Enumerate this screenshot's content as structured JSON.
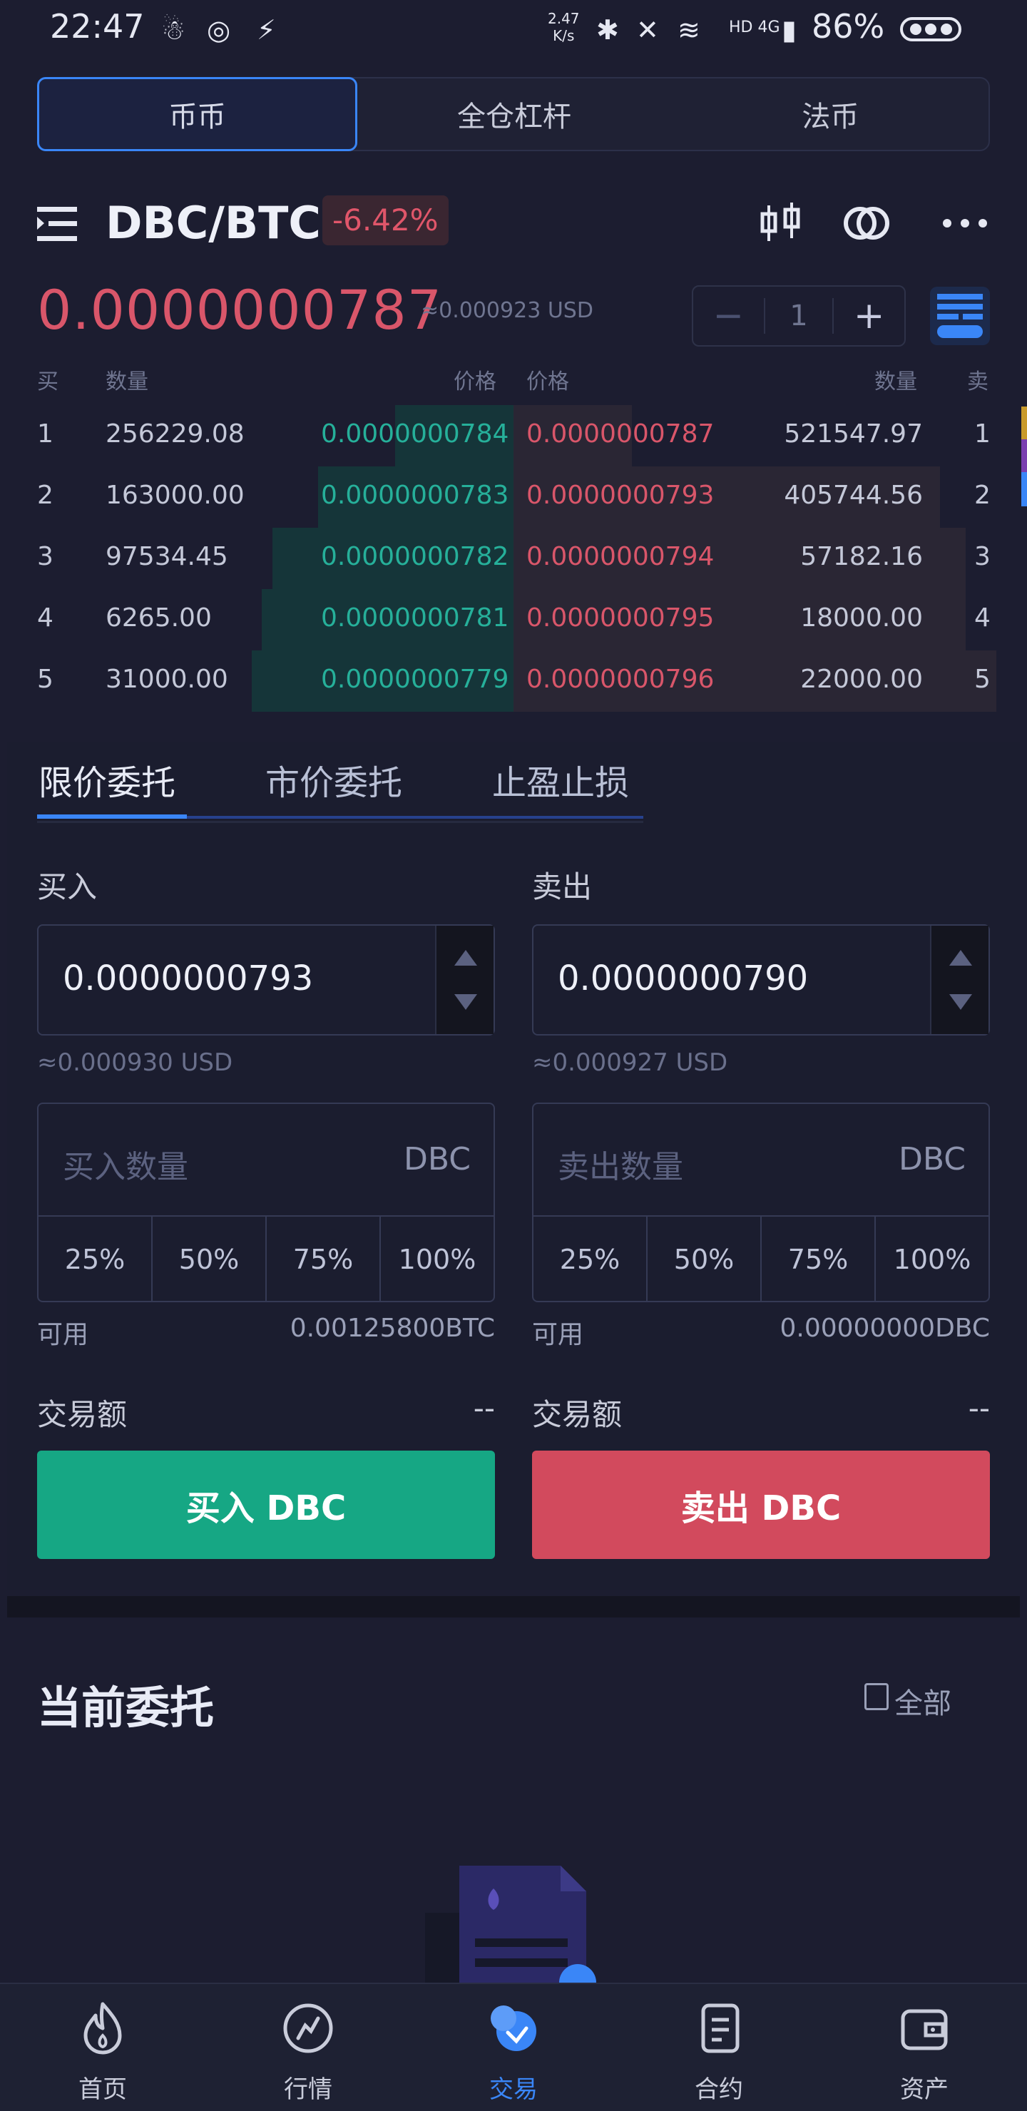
{
  "status_bar": {
    "time": "22:47",
    "net_speed_value": "2.47",
    "net_speed_unit": "K/s",
    "network": "HD 4G",
    "battery": "86%"
  },
  "top_tabs": [
    {
      "label": "币币",
      "active": true
    },
    {
      "label": "全仓杠杆",
      "active": false
    },
    {
      "label": "法币",
      "active": false
    }
  ],
  "pair": {
    "name": "DBC/BTC",
    "change": "-6.42%"
  },
  "price": {
    "last": "0.0000000787",
    "usd": "≈0.000923 USD"
  },
  "depth_stepper": {
    "minus": "−",
    "value": "1",
    "plus": "+"
  },
  "orderbook": {
    "headers": {
      "buy": "买",
      "bid_qty": "数量",
      "bid_price": "价格",
      "ask_price": "价格",
      "ask_qty": "数量",
      "sell": "卖"
    },
    "rows": [
      {
        "idx": "1",
        "bid_qty": "256229.08",
        "bid_price": "0.0000000784",
        "ask_price": "0.0000000787",
        "ask_qty": "521547.97",
        "ask_idx": "1",
        "bid_depth": 0.23,
        "ask_depth": 0.23
      },
      {
        "idx": "2",
        "bid_qty": "163000.00",
        "bid_price": "0.0000000783",
        "ask_price": "0.0000000793",
        "ask_qty": "405744.56",
        "ask_idx": "2",
        "bid_depth": 0.38,
        "ask_depth": 0.83
      },
      {
        "idx": "3",
        "bid_qty": "97534.45",
        "bid_price": "0.0000000782",
        "ask_price": "0.0000000794",
        "ask_qty": "57182.16",
        "ask_idx": "3",
        "bid_depth": 0.47,
        "ask_depth": 0.88
      },
      {
        "idx": "4",
        "bid_qty": "6265.00",
        "bid_price": "0.0000000781",
        "ask_price": "0.0000000795",
        "ask_qty": "18000.00",
        "ask_idx": "4",
        "bid_depth": 0.49,
        "ask_depth": 0.88
      },
      {
        "idx": "5",
        "bid_qty": "31000.00",
        "bid_price": "0.0000000779",
        "ask_price": "0.0000000796",
        "ask_qty": "22000.00",
        "ask_idx": "5",
        "bid_depth": 0.51,
        "ask_depth": 0.94
      }
    ]
  },
  "order_tabs": [
    {
      "label": "限价委托",
      "active": true
    },
    {
      "label": "市价委托",
      "active": false
    },
    {
      "label": "止盈止损",
      "active": false
    }
  ],
  "buy": {
    "label": "买入",
    "price": "0.0000000793",
    "price_usd": "≈0.000930 USD",
    "qty_placeholder": "买入数量",
    "unit": "DBC",
    "percents": [
      "25%",
      "50%",
      "75%",
      "100%"
    ],
    "avail_label": "可用",
    "avail_value": "0.00125800BTC",
    "amount_label": "交易额",
    "amount_value": "--",
    "button": "买入 DBC"
  },
  "sell": {
    "label": "卖出",
    "price": "0.0000000790",
    "price_usd": "≈0.000927 USD",
    "qty_placeholder": "卖出数量",
    "unit": "DBC",
    "percents": [
      "25%",
      "50%",
      "75%",
      "100%"
    ],
    "avail_label": "可用",
    "avail_value": "0.00000000DBC",
    "amount_label": "交易额",
    "amount_value": "--",
    "button": "卖出 DBC"
  },
  "orders": {
    "title": "当前委托",
    "all_label": "全部"
  },
  "bottom_nav": [
    {
      "label": "首页",
      "icon": "flame-icon",
      "active": false
    },
    {
      "label": "行情",
      "icon": "market-icon",
      "active": false
    },
    {
      "label": "交易",
      "icon": "trade-icon",
      "active": true
    },
    {
      "label": "合约",
      "icon": "contract-icon",
      "active": false
    },
    {
      "label": "资产",
      "icon": "wallet-icon",
      "active": false
    }
  ],
  "colors": {
    "bg": "#1c1d30",
    "accent": "#3a86f7",
    "buy": "#16a784",
    "sell": "#d24a5d",
    "bid_price": "#26b09a",
    "ask_price": "#d9566a"
  }
}
